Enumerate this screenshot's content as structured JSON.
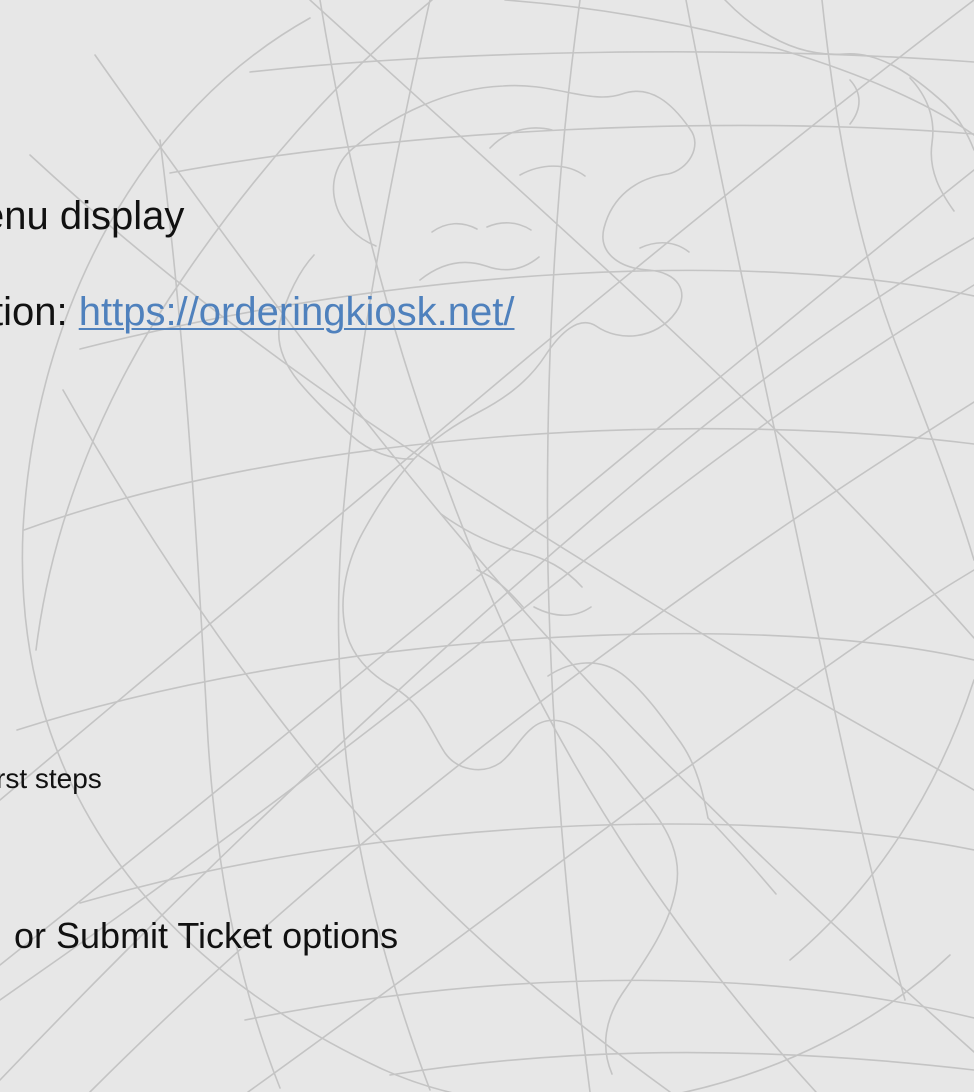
{
  "slide": {
    "background_color": "#e7e7e7",
    "line_color": "#c4c4c4",
    "link_color": "#4f81bd",
    "background_graphic": "globe-with-latitude-longitude-lines"
  },
  "content": {
    "line_1": "enu display",
    "line_2_prefix": "tion: ",
    "line_2_link": "https://orderingkiosk.net/",
    "line_3": "rst steps",
    "line_4": "or Submit Ticket options"
  }
}
